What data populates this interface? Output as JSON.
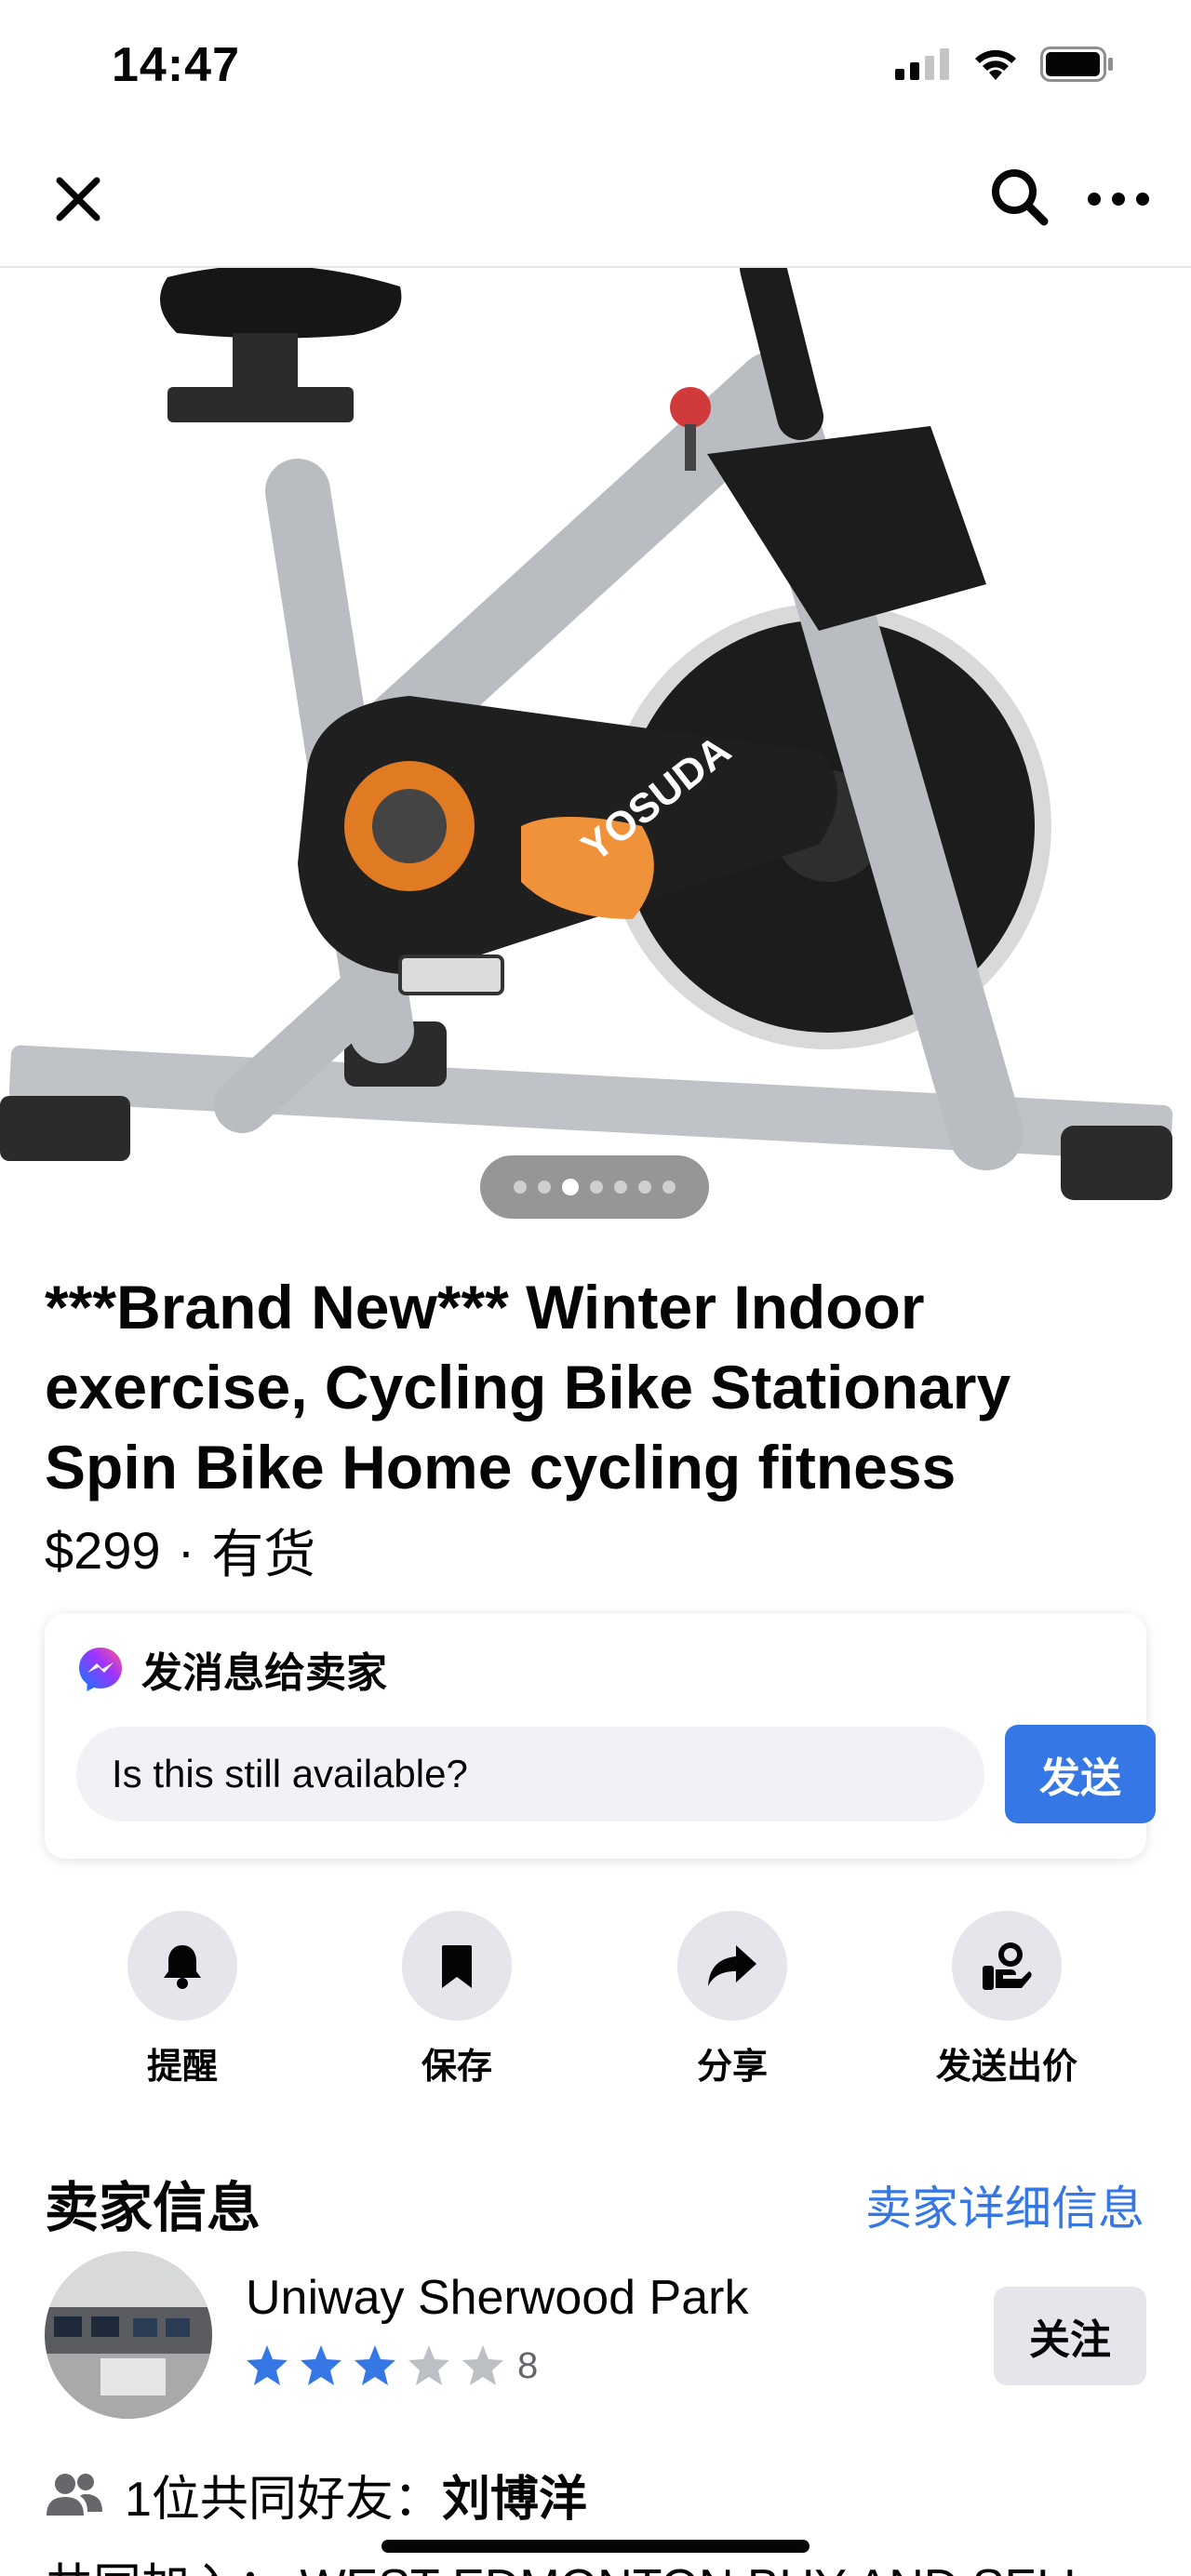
{
  "status_bar": {
    "time": "14:47"
  },
  "nav": {
    "close_icon": "close-icon",
    "search_icon": "search-icon",
    "more_icon": "more-icon"
  },
  "listing": {
    "title": "***Brand New*** Winter Indoor exercise, Cycling Bike Stationary Spin Bike Home cycling fitness",
    "image_brand_text": "YOSUDA",
    "pager": {
      "count": 7,
      "active_index": 2
    },
    "price": "$299",
    "separator": "·",
    "availability": "有货"
  },
  "message_card": {
    "heading": "发消息给卖家",
    "input_value": "Is this still available?",
    "send_label": "发送"
  },
  "actions": [
    {
      "label": "提醒",
      "icon": "bell-icon"
    },
    {
      "label": "保存",
      "icon": "bookmark-icon"
    },
    {
      "label": "分享",
      "icon": "share-icon"
    },
    {
      "label": "发送出价",
      "icon": "offer-icon"
    }
  ],
  "seller": {
    "section_title": "卖家信息",
    "details_link": "卖家详细信息",
    "name": "Uniway Sherwood Park",
    "rating": 3,
    "rating_max": 5,
    "rating_count": "8",
    "follow_label": "关注"
  },
  "mutual_friends": {
    "prefix": "1位共同好友：",
    "name": "刘博洋"
  },
  "peek_text": "共同加入： WEST EDMONTON BUY AND SELL",
  "colors": {
    "accent": "#3578e5",
    "star_on": "#3578e5",
    "star_off": "#bcc0c4",
    "button_bg": "#e4e6eb"
  }
}
